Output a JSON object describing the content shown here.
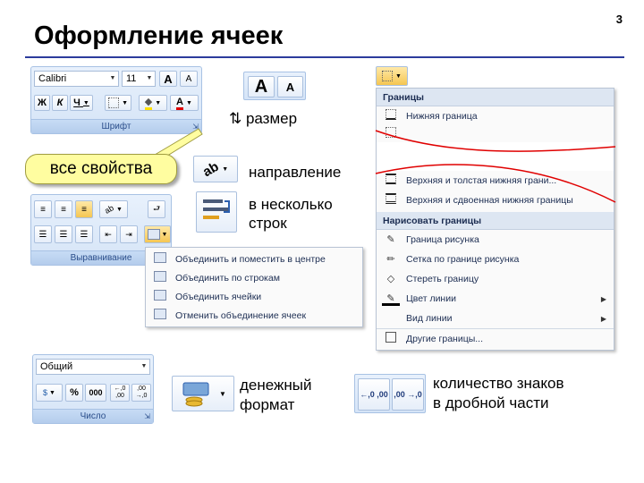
{
  "slide": {
    "title": "Оформление ячеек",
    "page_number": "3"
  },
  "font_group": {
    "label": "Шрифт",
    "font_name": "Calibri",
    "font_size": "11",
    "grow_label": "A",
    "shrink_label": "A",
    "bold_label": "Ж",
    "italic_label": "К",
    "underline_label": "Ч",
    "fill_label": "◆",
    "color_label": "A"
  },
  "callout": {
    "text": "все свойства"
  },
  "size_feature": {
    "grow_label": "A",
    "shrink_label": "A",
    "caption": "⇅ размер"
  },
  "orientation_feature": {
    "caption": "направление"
  },
  "wrap_feature": {
    "caption_line1": "в несколько",
    "caption_line2": "строк"
  },
  "alignment_group": {
    "label": "Выравнивание"
  },
  "merge_menu": {
    "items": [
      {
        "label": "Объединить и поместить в центре"
      },
      {
        "label": "Объединить по строкам"
      },
      {
        "label": "Объединить ячейки"
      },
      {
        "label": "Отменить объединение ячеек"
      }
    ]
  },
  "borders_menu": {
    "header1": "Границы",
    "item_bottom": "Нижняя граница",
    "item_top_thick_bottom": "Верхняя и толстая нижняя грани...",
    "item_top_double_bottom": "Верхняя и сдвоенная нижняя границы",
    "header2": "Нарисовать границы",
    "draw_items": [
      {
        "label": "Граница рисунка",
        "submenu": false
      },
      {
        "label": "Сетка по границе рисунка",
        "submenu": false
      },
      {
        "label": "Стереть границу",
        "submenu": false
      },
      {
        "label": "Цвет линии",
        "submenu": true
      },
      {
        "label": "Вид линии",
        "submenu": true
      },
      {
        "label": "Другие границы...",
        "submenu": false
      }
    ]
  },
  "number_group": {
    "label": "Число",
    "format_value": "Общий",
    "percent_label": "%",
    "thousands_label": "000",
    "inc_decimal_label": "←,0 ,00",
    "dec_decimal_label": ",00 →,0"
  },
  "currency_feature": {
    "caption_line1": "денежный",
    "caption_line2": "формат"
  },
  "decimal_feature": {
    "caption_line1": "количество знаков",
    "caption_line2": "в дробной части"
  },
  "colors": {
    "title_rule": "#2c3c9c",
    "callout_fill": "#fffda0",
    "ribbon_label": "#2a4d8a",
    "menu_text": "#1c2d52"
  }
}
